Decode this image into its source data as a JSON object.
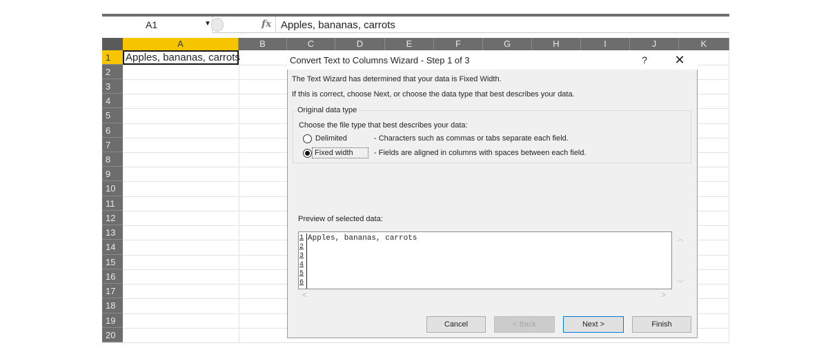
{
  "formula_bar": {
    "name_box": "A1",
    "fx_label": "fx",
    "formula": "Apples, bananas, carrots"
  },
  "sheet": {
    "columns": [
      "A",
      "B",
      "C",
      "D",
      "E",
      "F",
      "G",
      "H",
      "I",
      "J",
      "K"
    ],
    "rows": [
      "1",
      "2",
      "3",
      "4",
      "5",
      "6",
      "7",
      "8",
      "9",
      "10",
      "11",
      "12",
      "13",
      "14",
      "15",
      "16",
      "17",
      "18",
      "19",
      "20"
    ],
    "cells": {
      "A1": "Apples, bananas, carrots"
    },
    "header_color": "#6d6d6d",
    "selected_header_color": "#f6c500"
  },
  "dialog": {
    "title": "Convert Text to Columns Wizard - Step 1 of 3",
    "help": "?",
    "close": "✕",
    "intro_line1": "The Text Wizard has determined that your data is Fixed Width.",
    "intro_line2": "If this is correct, choose Next, or choose the data type that best describes your data.",
    "group_label": "Original data type",
    "choose_label": "Choose the file type that best describes your data:",
    "options": [
      {
        "label": "Delimited",
        "description": "- Characters such as commas or tabs separate each field.",
        "selected": false
      },
      {
        "label": "Fixed width",
        "description": "- Fields are aligned in columns with spaces between each field.",
        "selected": true
      }
    ],
    "preview_label": "Preview of selected data:",
    "preview_line_numbers": [
      "1",
      "2",
      "3",
      "4",
      "5",
      "6"
    ],
    "preview_lines": [
      "Apples, bananas, carrots"
    ],
    "buttons": {
      "cancel": "Cancel",
      "back": "< Back",
      "next": "Next >",
      "finish": "Finish"
    },
    "accent_color": "#0078d7"
  }
}
